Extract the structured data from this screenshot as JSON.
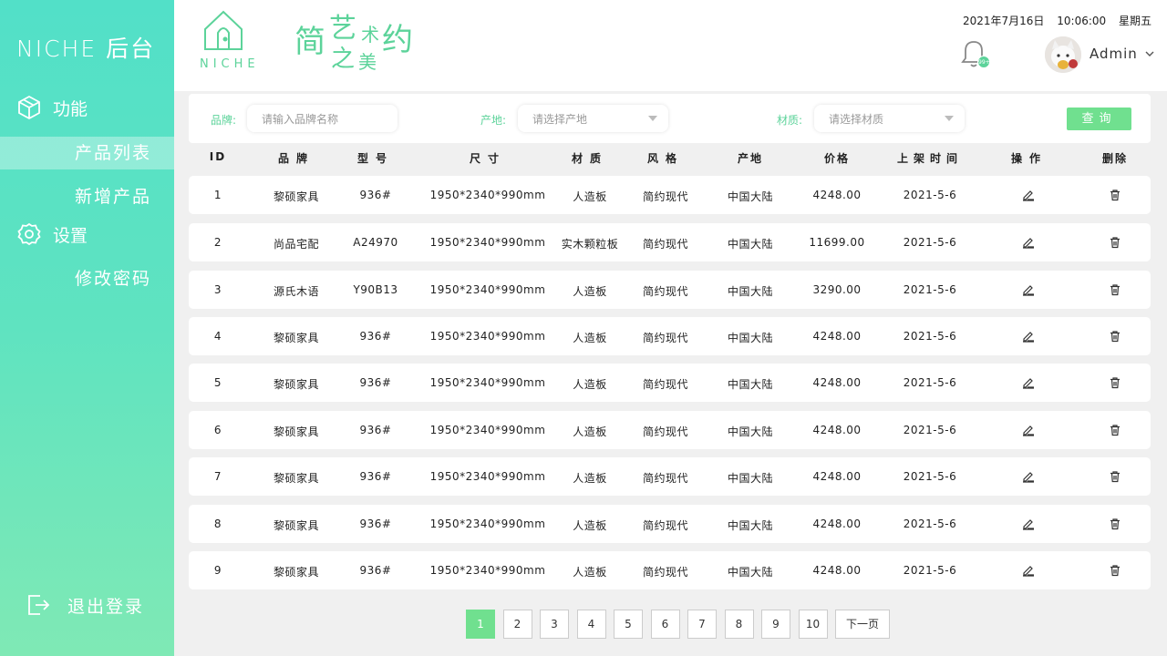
{
  "sidebar": {
    "title": "NICHE 后台",
    "sections": [
      {
        "label": "功能",
        "icon": "cube-icon"
      },
      {
        "label": "设置",
        "icon": "gear-icon"
      }
    ],
    "items": [
      {
        "label": "产品列表",
        "active": true
      },
      {
        "label": "新增产品",
        "active": false
      },
      {
        "label": "修改密码",
        "active": false
      }
    ],
    "logout": "退出登录"
  },
  "header": {
    "logo_text": "NICHE",
    "slogan": [
      "简",
      "艺",
      "术",
      "约",
      "之",
      "美"
    ],
    "date": "2021年7月16日",
    "time": "10:06:00",
    "weekday": "星期五",
    "notification_badge": "99+",
    "user": "Admin"
  },
  "filter": {
    "brand_label": "品牌:",
    "brand_placeholder": "请输入品牌名称",
    "origin_label": "产地:",
    "origin_placeholder": "请选择产地",
    "material_label": "材质:",
    "material_placeholder": "请选择材质",
    "search_button": "查询"
  },
  "table": {
    "headers": [
      "ID",
      "品牌",
      "型号",
      "尺寸",
      "材质",
      "风格",
      "产地",
      "价格",
      "上架时间",
      "操作",
      "删除"
    ],
    "rows": [
      {
        "id": "1",
        "brand": "黎硕家具",
        "model": "936#",
        "size": "1950*2340*990mm",
        "material": "人造板",
        "style": "简约现代",
        "origin": "中国大陆",
        "price": "4248.00",
        "date": "2021-5-6"
      },
      {
        "id": "2",
        "brand": "尚品宅配",
        "model": "A24970",
        "size": "1950*2340*990mm",
        "material": "实木颗粒板",
        "style": "简约现代",
        "origin": "中国大陆",
        "price": "11699.00",
        "date": "2021-5-6"
      },
      {
        "id": "3",
        "brand": "源氏木语",
        "model": "Y90B13",
        "size": "1950*2340*990mm",
        "material": "人造板",
        "style": "简约现代",
        "origin": "中国大陆",
        "price": "3290.00",
        "date": "2021-5-6"
      },
      {
        "id": "4",
        "brand": "黎硕家具",
        "model": "936#",
        "size": "1950*2340*990mm",
        "material": "人造板",
        "style": "简约现代",
        "origin": "中国大陆",
        "price": "4248.00",
        "date": "2021-5-6"
      },
      {
        "id": "5",
        "brand": "黎硕家具",
        "model": "936#",
        "size": "1950*2340*990mm",
        "material": "人造板",
        "style": "简约现代",
        "origin": "中国大陆",
        "price": "4248.00",
        "date": "2021-5-6"
      },
      {
        "id": "6",
        "brand": "黎硕家具",
        "model": "936#",
        "size": "1950*2340*990mm",
        "material": "人造板",
        "style": "简约现代",
        "origin": "中国大陆",
        "price": "4248.00",
        "date": "2021-5-6"
      },
      {
        "id": "7",
        "brand": "黎硕家具",
        "model": "936#",
        "size": "1950*2340*990mm",
        "material": "人造板",
        "style": "简约现代",
        "origin": "中国大陆",
        "price": "4248.00",
        "date": "2021-5-6"
      },
      {
        "id": "8",
        "brand": "黎硕家具",
        "model": "936#",
        "size": "1950*2340*990mm",
        "material": "人造板",
        "style": "简约现代",
        "origin": "中国大陆",
        "price": "4248.00",
        "date": "2021-5-6"
      },
      {
        "id": "9",
        "brand": "黎硕家具",
        "model": "936#",
        "size": "1950*2340*990mm",
        "material": "人造板",
        "style": "简约现代",
        "origin": "中国大陆",
        "price": "4248.00",
        "date": "2021-5-6"
      }
    ]
  },
  "pagination": {
    "pages": [
      "1",
      "2",
      "3",
      "4",
      "5",
      "6",
      "7",
      "8",
      "9",
      "10"
    ],
    "current": "1",
    "next": "下一页"
  },
  "colors": {
    "accent": "#5cd39a",
    "button": "#70e08f",
    "sidebar_top": "#52e0c8",
    "sidebar_bottom": "#7fe9b5"
  }
}
